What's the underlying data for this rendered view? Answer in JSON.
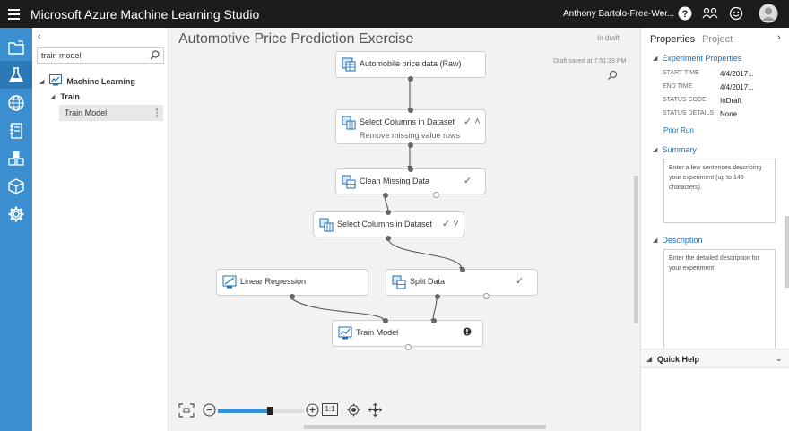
{
  "topbar": {
    "app_title": "Microsoft Azure Machine Learning Studio",
    "user_name": "Anthony Bartolo-Free-Wor...",
    "user_caret": "▾",
    "icons": [
      "menu-icon",
      "help-icon",
      "community-icon",
      "feedback-smile-icon",
      "user-avatar-icon"
    ]
  },
  "leftnav": {
    "items": [
      "projects-icon",
      "experiments-icon",
      "web-services-icon",
      "notebooks-icon",
      "datasets-icon",
      "trained-models-icon",
      "settings-icon"
    ]
  },
  "palette": {
    "collapse": "‹",
    "search_value": "train model",
    "tree": {
      "root_caret": "◢",
      "root_label": "Machine Learning",
      "child_caret": "◢",
      "child_label": "Train",
      "leaf_label": "Train Model"
    }
  },
  "canvas": {
    "title": "Automotive Price Prediction Exercise",
    "status": "In draft",
    "saved": "Draft saved at 7:51:33 PM",
    "modules": {
      "auto_price": {
        "title": "Automobile price data (Raw)"
      },
      "select1": {
        "title": "Select Columns in Dataset",
        "sub": "Remove missing value rows",
        "status": "✓ ˄"
      },
      "clean": {
        "title": "Clean Missing Data",
        "status": "✓"
      },
      "select2": {
        "title": "Select Columns in Dataset",
        "status": "✓ ˅"
      },
      "linreg": {
        "title": "Linear Regression"
      },
      "split": {
        "title": "Split Data",
        "status": "✓"
      },
      "train": {
        "title": "Train Model",
        "status": "!"
      }
    },
    "zoom": {
      "fit_label": "fit-to-screen-icon",
      "reset_label": "1:1",
      "level": 0.6
    }
  },
  "properties": {
    "tab_properties": "Properties",
    "tab_project": "Project",
    "collapse": "›",
    "exp_section": "Experiment Properties",
    "rows": [
      {
        "label": "START TIME",
        "value": "4/4/2017..."
      },
      {
        "label": "END TIME",
        "value": "4/4/2017..."
      },
      {
        "label": "STATUS CODE",
        "value": "InDraft"
      },
      {
        "label": "STATUS DETAILS",
        "value": "None"
      }
    ],
    "prior_run": "Prior Run",
    "summary_section": "Summary",
    "summary_placeholder": "Enter a few sentences describing your experiment (up to 140 characters).",
    "description_section": "Description",
    "description_placeholder": "Enter the detailed description for your experiment.",
    "quick_help": "Quick Help"
  }
}
